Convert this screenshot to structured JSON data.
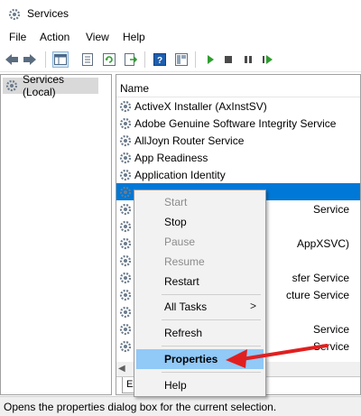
{
  "window": {
    "title": "Services"
  },
  "menubar": [
    "File",
    "Action",
    "View",
    "Help"
  ],
  "tree": {
    "root_label": "Services (Local)"
  },
  "list": {
    "column_header": "Name",
    "rows": [
      "ActiveX Installer (AxInstSV)",
      "Adobe Genuine Software Integrity Service",
      "AllJoyn Router Service",
      "App Readiness",
      "Application Identity",
      "",
      "Service",
      "",
      "AppXSVC)",
      "",
      "sfer Service",
      "cture Service",
      "",
      "Service",
      "Service"
    ],
    "selected_index": 5,
    "tab_label": "Ex"
  },
  "context_menu": {
    "items": [
      {
        "label": "Start",
        "enabled": false
      },
      {
        "label": "Stop",
        "enabled": true
      },
      {
        "label": "Pause",
        "enabled": false
      },
      {
        "label": "Resume",
        "enabled": false
      },
      {
        "label": "Restart",
        "enabled": true
      },
      {
        "label": "All Tasks",
        "enabled": true,
        "submenu_glyph": ">"
      },
      {
        "label": "Refresh",
        "enabled": true
      },
      {
        "label": "Properties",
        "enabled": true,
        "highlighted": true
      },
      {
        "label": "Help",
        "enabled": true
      }
    ]
  },
  "status": {
    "text": "Opens the properties dialog box for the current selection."
  },
  "colors": {
    "selection": "#0078d7",
    "menu_highlight": "#91c9f7",
    "annotation_arrow": "#e02020",
    "toolbar_play": "#2e9e2e",
    "toolbar_stop": "#4a4a4a"
  },
  "toolbar_icons": [
    "back-icon",
    "forward-icon",
    "show-hide-tree-icon",
    "properties-icon",
    "refresh-icon",
    "export-list-icon",
    "help-icon",
    "snapin-view-icon",
    "start-service-icon",
    "stop-service-icon",
    "pause-service-icon",
    "restart-service-icon"
  ]
}
